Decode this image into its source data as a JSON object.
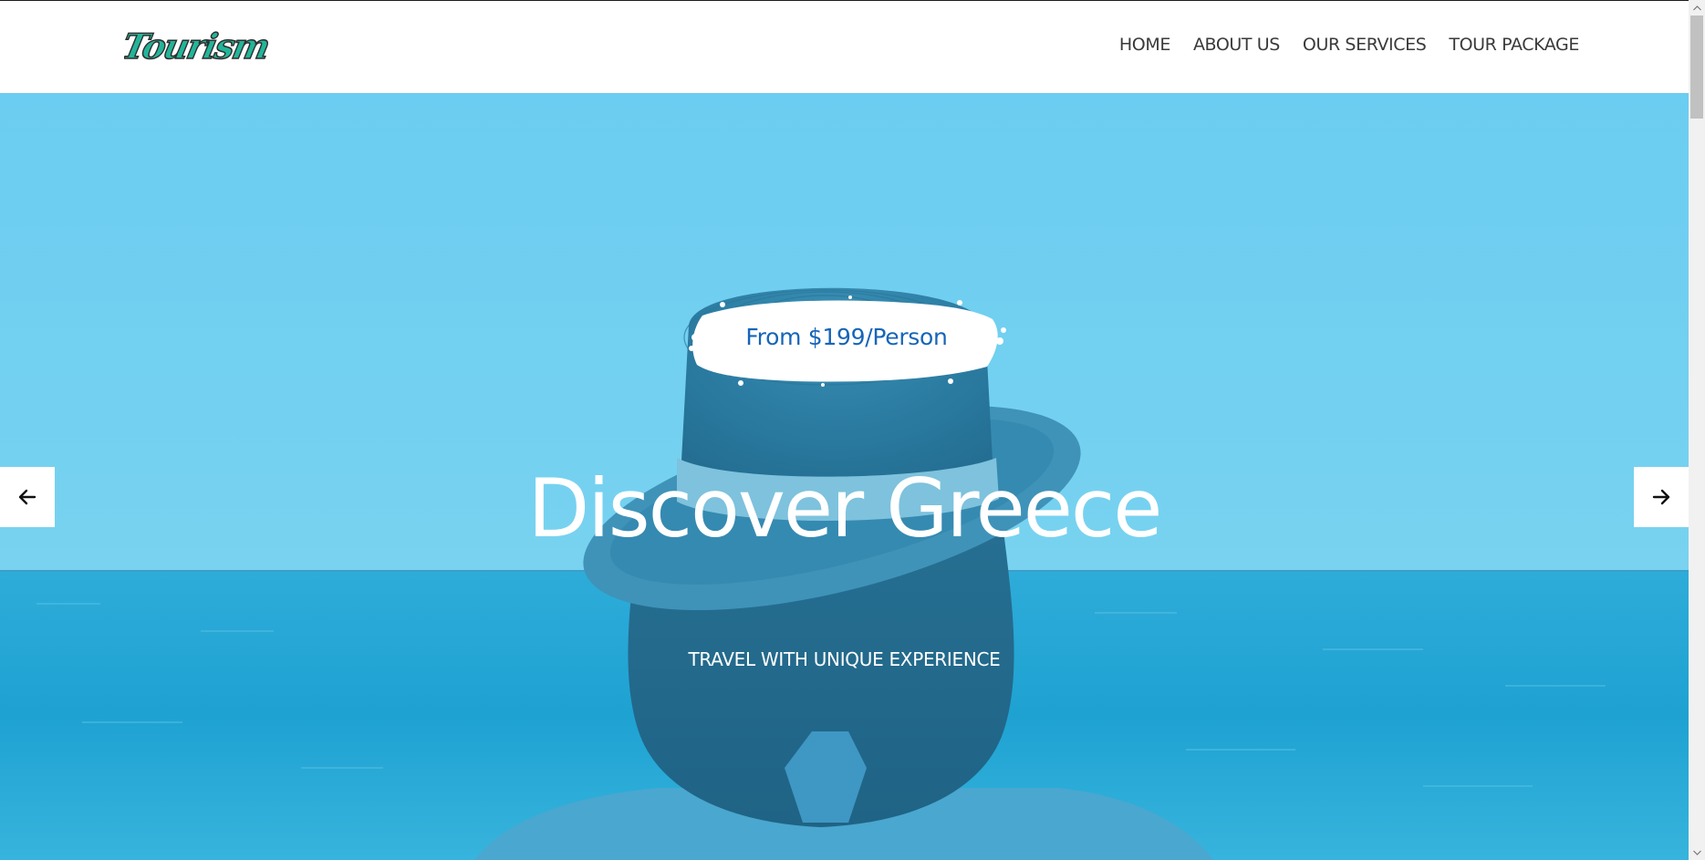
{
  "header": {
    "logo_text": "Tourism",
    "nav": [
      {
        "label": "HOME"
      },
      {
        "label": "ABOUT US"
      },
      {
        "label": "OUR SERVICES"
      },
      {
        "label": "TOUR PACKAGE"
      }
    ]
  },
  "hero": {
    "price_badge": "From $199/Person",
    "title": "Discover Greece",
    "subtitle": "TRAVEL WITH UNIQUE EXPERIENCE",
    "prev_icon": "arrow-left-icon",
    "next_icon": "arrow-right-icon"
  },
  "colors": {
    "sky": "#6dcdf0",
    "sea": "#1ea4d4",
    "overlay_text": "#ffffff",
    "price_text": "#1665b8",
    "nav_text": "#3a3a3a"
  }
}
